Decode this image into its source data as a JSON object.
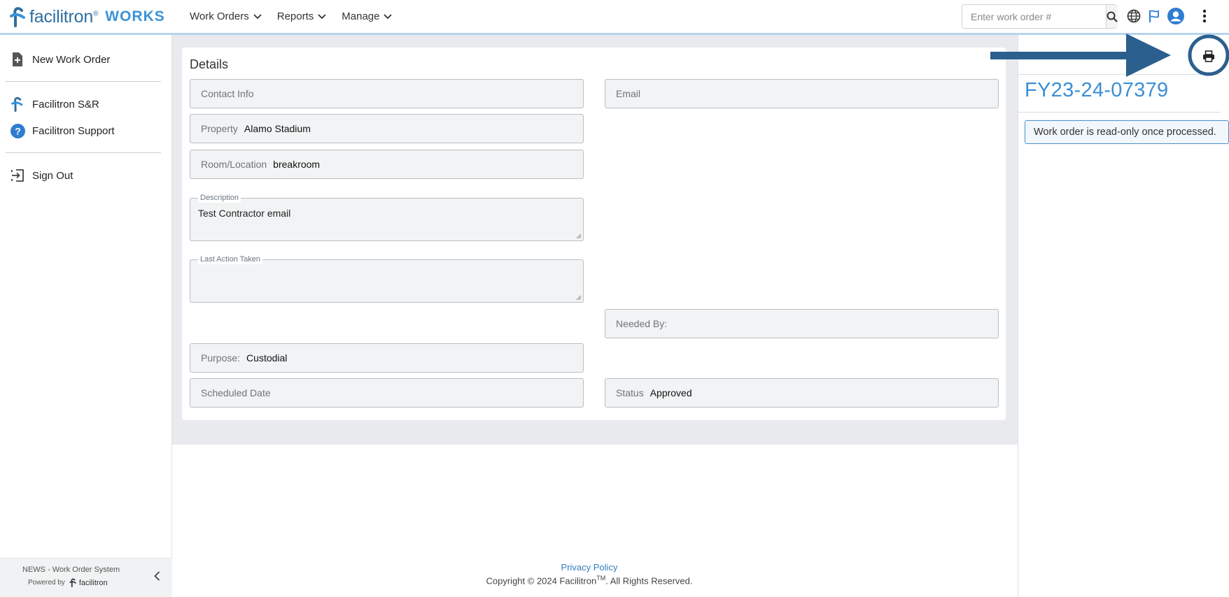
{
  "header": {
    "brand_name": "facilitron",
    "brand_tm": "®",
    "brand_product": "WORKS",
    "nav": [
      {
        "label": "Work Orders"
      },
      {
        "label": "Reports"
      },
      {
        "label": "Manage"
      }
    ],
    "search_placeholder": "Enter work order #"
  },
  "sidebar": {
    "new_work_order": "New Work Order",
    "sr_link": "Facilitron S&R",
    "support_link": "Facilitron Support",
    "sign_out": "Sign Out",
    "footer_system": "NEWS - Work Order System",
    "footer_powered": "Powered by",
    "footer_brand": "facilitron"
  },
  "details": {
    "title": "Details",
    "contact_label": "Contact Info",
    "email_label": "Email",
    "property_label": "Property",
    "property_value": "Alamo Stadium",
    "room_label": "Room/Location",
    "room_value": "breakroom",
    "description_label": "Description",
    "description_value": "Test Contractor email",
    "last_action_label": "Last Action Taken",
    "last_action_value": "",
    "needed_by_label": "Needed By:",
    "purpose_label": "Purpose:",
    "purpose_value": "Custodial",
    "scheduled_label": "Scheduled Date",
    "status_label": "Status",
    "status_value": "Approved"
  },
  "right_panel": {
    "work_order_number": "FY23-24-07379",
    "notice": "Work order is read-only once processed."
  },
  "footer": {
    "privacy": "Privacy Policy",
    "copyright_pre": "Copyright © 2024 Facilitron",
    "copyright_tm": "TM",
    "copyright_post": ". All Rights Reserved."
  },
  "colors": {
    "brand_blue": "#3a93d8",
    "annotation_arrow": "#2b5f8e"
  }
}
